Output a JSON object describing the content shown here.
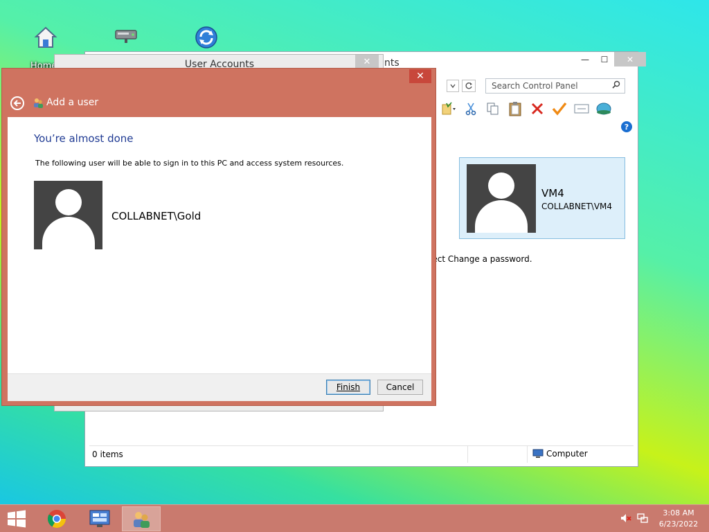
{
  "desktop": {
    "icons": [
      {
        "name": "home-icon",
        "label": "Home"
      },
      {
        "name": "network-drive-icon",
        "label": ""
      },
      {
        "name": "sync-icon",
        "label": ""
      }
    ]
  },
  "control_panel": {
    "title_fragment": "nts",
    "minimize_glyph": "—",
    "maximize_glyph": "☐",
    "close_glyph": "✕",
    "search_placeholder": "Search Control Panel",
    "user_card": {
      "display_name": "VM4",
      "domain_name": "COLLABNET\\VM4"
    },
    "instruction_fragment": "lect Change a password.",
    "status_items": "0 items",
    "status_location": "Computer"
  },
  "user_accounts_window": {
    "title": "User Accounts",
    "close_glyph": "✕"
  },
  "dialog": {
    "close_glyph": "✕",
    "heading": "Add a user",
    "title": "You’re almost done",
    "description": "The following user will be able to sign in to this PC and access system resources.",
    "username": "COLLABNET\\Gold",
    "finish_label": "Finish",
    "cancel_label": "Cancel"
  },
  "taskbar": {
    "clock_time": "3:08 AM",
    "clock_date": "6/23/2022",
    "apps": [
      "chrome-icon",
      "server-manager-icon",
      "user-accounts-icon"
    ]
  },
  "colors": {
    "dialog_frame": "#cf7360",
    "taskbar": "#c97a6e",
    "selection": "#ddeffa",
    "title_text": "#1f3a93"
  }
}
